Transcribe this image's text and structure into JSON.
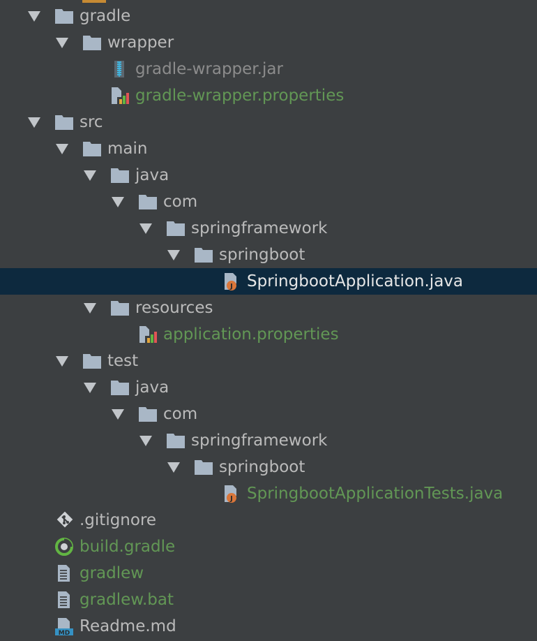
{
  "tree": {
    "items": [
      {
        "label": "gradle",
        "depth": 0,
        "type": "folder",
        "expanded": true,
        "color": "default"
      },
      {
        "label": "wrapper",
        "depth": 1,
        "type": "folder",
        "expanded": true,
        "color": "default"
      },
      {
        "label": "gradle-wrapper.jar",
        "depth": 2,
        "type": "jar",
        "color": "gray"
      },
      {
        "label": "gradle-wrapper.properties",
        "depth": 2,
        "type": "properties",
        "color": "green"
      },
      {
        "label": "src",
        "depth": 0,
        "type": "folder",
        "expanded": true,
        "color": "default"
      },
      {
        "label": "main",
        "depth": 1,
        "type": "folder",
        "expanded": true,
        "color": "default"
      },
      {
        "label": "java",
        "depth": 2,
        "type": "folder",
        "expanded": true,
        "color": "default"
      },
      {
        "label": "com",
        "depth": 3,
        "type": "folder",
        "expanded": true,
        "color": "default"
      },
      {
        "label": "springframework",
        "depth": 4,
        "type": "folder",
        "expanded": true,
        "color": "default"
      },
      {
        "label": "springboot",
        "depth": 5,
        "type": "folder",
        "expanded": true,
        "color": "default"
      },
      {
        "label": "SpringbootApplication.java",
        "depth": 6,
        "type": "java",
        "color": "default",
        "selected": true
      },
      {
        "label": "resources",
        "depth": 2,
        "type": "folder",
        "expanded": true,
        "color": "default"
      },
      {
        "label": "application.properties",
        "depth": 3,
        "type": "properties",
        "color": "green"
      },
      {
        "label": "test",
        "depth": 1,
        "type": "folder",
        "expanded": true,
        "color": "default"
      },
      {
        "label": "java",
        "depth": 2,
        "type": "folder",
        "expanded": true,
        "color": "default"
      },
      {
        "label": "com",
        "depth": 3,
        "type": "folder",
        "expanded": true,
        "color": "default"
      },
      {
        "label": "springframework",
        "depth": 4,
        "type": "folder",
        "expanded": true,
        "color": "default"
      },
      {
        "label": "springboot",
        "depth": 5,
        "type": "folder",
        "expanded": true,
        "color": "default"
      },
      {
        "label": "SpringbootApplicationTests.java",
        "depth": 6,
        "type": "java",
        "color": "green"
      },
      {
        "label": ".gitignore",
        "depth": 0,
        "type": "gitignore",
        "color": "default"
      },
      {
        "label": "build.gradle",
        "depth": 0,
        "type": "gradle",
        "color": "green"
      },
      {
        "label": "gradlew",
        "depth": 0,
        "type": "text",
        "color": "green"
      },
      {
        "label": "gradlew.bat",
        "depth": 0,
        "type": "text",
        "color": "green"
      },
      {
        "label": "Readme.md",
        "depth": 0,
        "type": "markdown",
        "color": "default"
      }
    ]
  },
  "icon_names": {
    "folder": "folder-icon",
    "jar": "jar-file-icon",
    "properties": "properties-file-icon",
    "java": "java-class-icon",
    "gitignore": "gitignore-icon",
    "gradle": "gradle-icon",
    "text": "text-file-icon",
    "markdown": "markdown-file-icon"
  },
  "colors": {
    "background": "#3c3f41",
    "selection": "#0d293e",
    "text_default": "#bbbbbb",
    "text_green": "#629755",
    "text_gray": "#8c8c8c",
    "folder": "#a9b7c6"
  }
}
